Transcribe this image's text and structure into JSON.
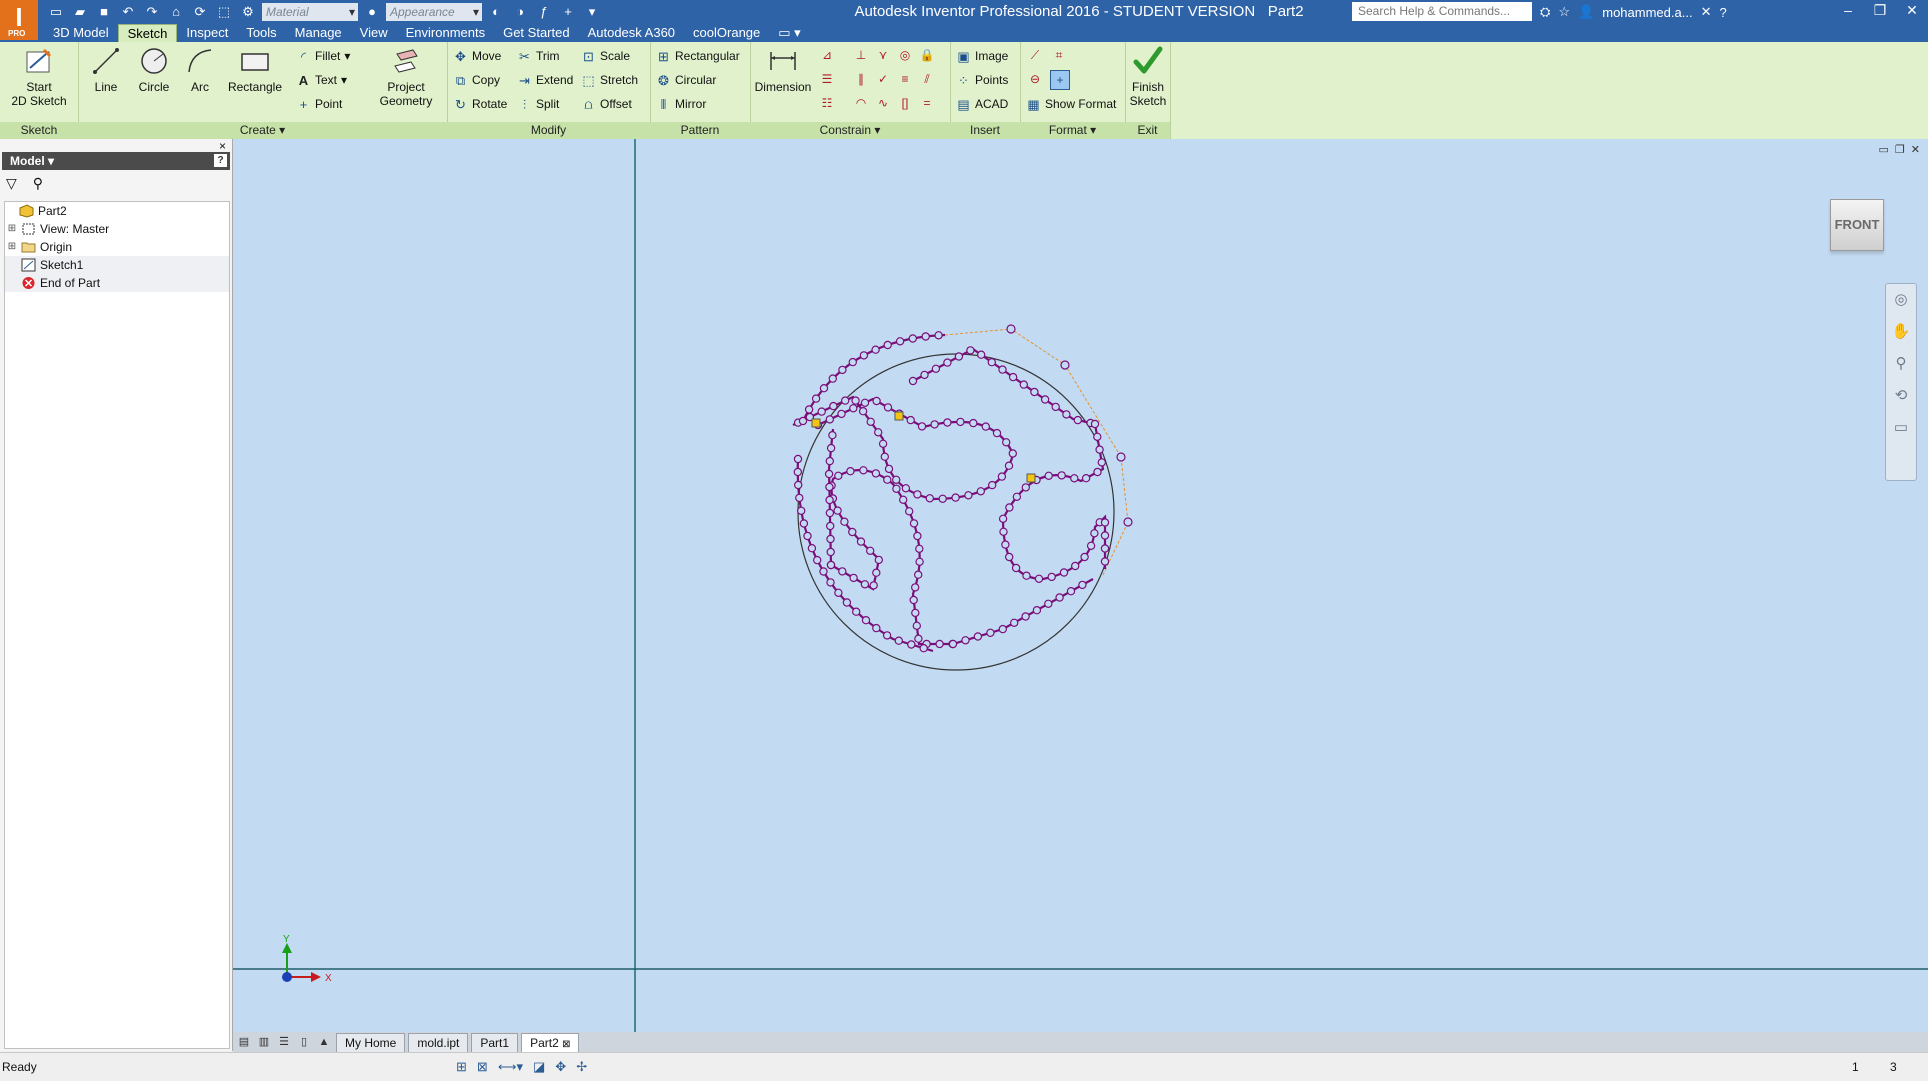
{
  "app": {
    "logo": "I",
    "logo_sub": "PRO",
    "title": "Autodesk Inventor Professional 2016 - STUDENT VERSION",
    "document": "Part2",
    "material_placeholder": "Material",
    "appearance_placeholder": "Appearance",
    "search_placeholder": "Search Help & Commands...",
    "user": "mohammed.a..."
  },
  "tabs": [
    "3D Model",
    "Sketch",
    "Inspect",
    "Tools",
    "Manage",
    "View",
    "Environments",
    "Get Started",
    "Autodesk A360",
    "coolOrange"
  ],
  "ribbon": {
    "sketch_panel": {
      "label": "Sketch",
      "start_line1": "Start",
      "start_line2": "2D Sketch"
    },
    "create_panel": {
      "label": "Create ▾",
      "line": "Line",
      "circle": "Circle",
      "arc": "Arc",
      "rectangle": "Rectangle",
      "fillet": "Fillet",
      "text": "Text",
      "point": "Point",
      "project_line1": "Project",
      "project_line2": "Geometry"
    },
    "modify_panel": {
      "label": "Modify",
      "move": "Move",
      "copy": "Copy",
      "rotate": "Rotate",
      "trim": "Trim",
      "extend": "Extend",
      "split": "Split",
      "scale": "Scale",
      "stretch": "Stretch",
      "offset": "Offset"
    },
    "pattern_panel": {
      "label": "Pattern",
      "rectangular": "Rectangular",
      "circular": "Circular",
      "mirror": "Mirror"
    },
    "constrain_panel": {
      "label": "Constrain ▾",
      "dimension": "Dimension"
    },
    "insert_panel": {
      "label": "Insert",
      "image": "Image",
      "points": "Points",
      "acad": "ACAD"
    },
    "format_panel": {
      "label": "Format ▾",
      "show_format": "Show Format"
    },
    "exit_panel": {
      "label": "Exit",
      "finish_line1": "Finish",
      "finish_line2": "Sketch"
    }
  },
  "browser": {
    "header": "Model ▾",
    "help": "?",
    "close": "×",
    "tree": [
      {
        "label": "Part2"
      },
      {
        "label": "View: Master"
      },
      {
        "label": "Origin"
      },
      {
        "label": "Sketch1"
      },
      {
        "label": "End of Part"
      }
    ]
  },
  "viewport": {
    "viewcube_face": "FRONT",
    "axis_x": "X",
    "axis_y": "Y"
  },
  "doc_tabs": [
    "My Home",
    "mold.ipt",
    "Part1",
    "Part2"
  ],
  "status": {
    "text": "Ready",
    "count1": "1",
    "count2": "3"
  },
  "colors": {
    "titlebar": "#2f63a8",
    "ribbon": "#e0f1cc",
    "viewport": "#c3dbf2",
    "sketch": "#7a0f7a"
  }
}
